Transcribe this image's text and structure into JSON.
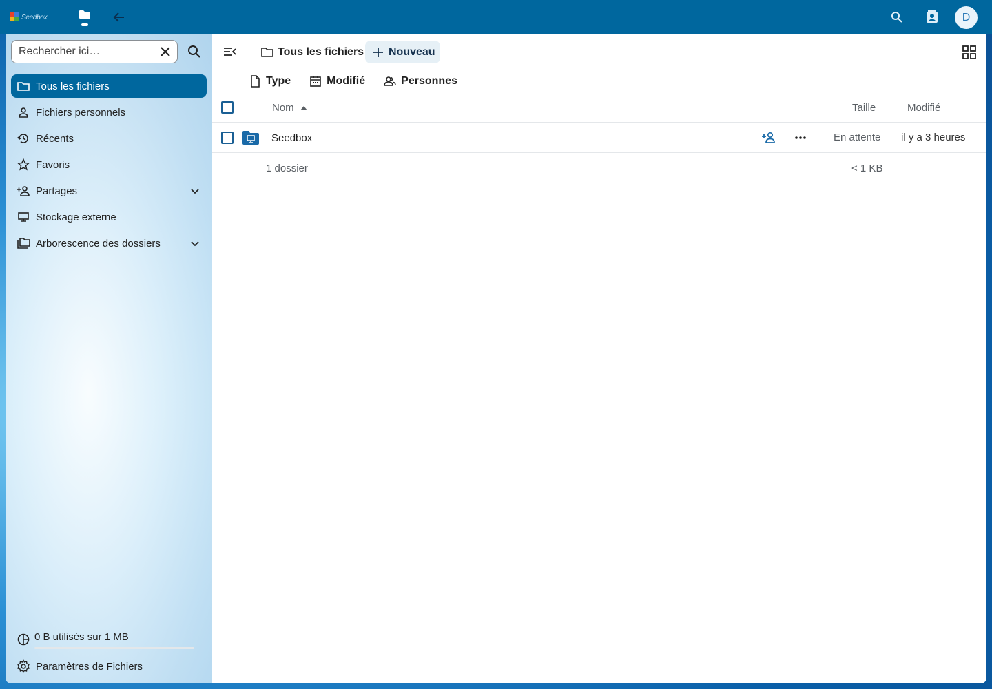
{
  "header": {
    "logo_text": "Seedbox",
    "app_icon": "folder-icon",
    "back_icon": "arrow-left-icon",
    "search_icon": "search-icon",
    "contacts_icon": "contacts-icon",
    "avatar_letter": "D",
    "brand_color": "#00679e"
  },
  "sidebar": {
    "search_placeholder": "Rechercher ici…",
    "search_value": "Rechercher ici…",
    "items": [
      {
        "label": "Tous les fichiers",
        "icon": "folder-outline-icon",
        "active": true
      },
      {
        "label": "Fichiers personnels",
        "icon": "account-icon"
      },
      {
        "label": "Récents",
        "icon": "history-icon"
      },
      {
        "label": "Favoris",
        "icon": "star-icon"
      },
      {
        "label": "Partages",
        "icon": "account-plus-icon",
        "expandable": true
      },
      {
        "label": "Stockage externe",
        "icon": "monitor-icon"
      },
      {
        "label": "Arborescence des dossiers",
        "icon": "folder-multiple-icon",
        "expandable": true
      }
    ],
    "quota": {
      "label": "0 B utilisés sur 1 MB",
      "used_fraction": 0.0
    },
    "settings_label": "Paramètres de Fichiers"
  },
  "main": {
    "breadcrumb": "Tous les fichiers",
    "new_button": "Nouveau",
    "filters": [
      {
        "label": "Type",
        "icon": "file-icon"
      },
      {
        "label": "Modifié",
        "icon": "calendar-icon"
      },
      {
        "label": "Personnes",
        "icon": "people-icon"
      }
    ],
    "columns": {
      "name": "Nom",
      "size": "Taille",
      "modified": "Modifié"
    },
    "rows": [
      {
        "name": "Seedbox",
        "size": "En attente",
        "modified": "il y a 3 heures",
        "icon": "external-folder-icon"
      }
    ],
    "summary": {
      "count": "1 dossier",
      "total_size": "< 1 KB"
    }
  }
}
